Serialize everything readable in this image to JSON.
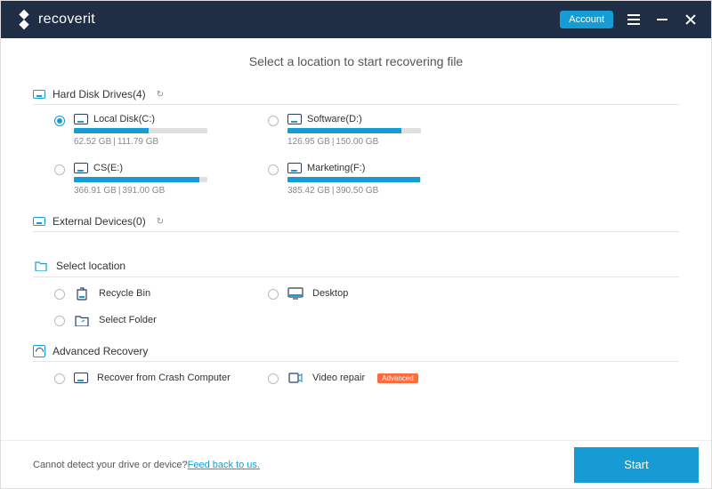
{
  "titlebar": {
    "brand": "recoverit",
    "account_label": "Account"
  },
  "heading": "Select a location to start recovering file",
  "sections": {
    "hdd_label": "Hard Disk Drives(4)",
    "ext_label": "External Devices(0)",
    "select_location_label": "Select location",
    "advanced_label": "Advanced Recovery"
  },
  "drives": [
    {
      "name": "Local Disk(C:)",
      "used": "62.52  GB",
      "total": "111.79  GB",
      "pct": 56,
      "selected": true
    },
    {
      "name": "Software(D:)",
      "used": "126.95  GB",
      "total": "150.00  GB",
      "pct": 85,
      "selected": false
    },
    {
      "name": "CS(E:)",
      "used": "366.91  GB",
      "total": "391.00  GB",
      "pct": 94,
      "selected": false
    },
    {
      "name": "Marketing(F:)",
      "used": "385.42  GB",
      "total": "390.50  GB",
      "pct": 99,
      "selected": false
    }
  ],
  "select_locations": [
    {
      "key": "recycle",
      "label": "Recycle Bin"
    },
    {
      "key": "desktop",
      "label": "Desktop"
    },
    {
      "key": "folder",
      "label": "Select Folder"
    }
  ],
  "advanced": {
    "crash_label": "Recover from Crash Computer",
    "video_label": "Video repair",
    "video_badge": "Advanced"
  },
  "footer": {
    "detect_text": "Cannot detect your drive or device? ",
    "feedback_link": "Feed back to us.",
    "start_label": "Start"
  },
  "colors": {
    "accent": "#169bd5",
    "header": "#1f2e44"
  }
}
